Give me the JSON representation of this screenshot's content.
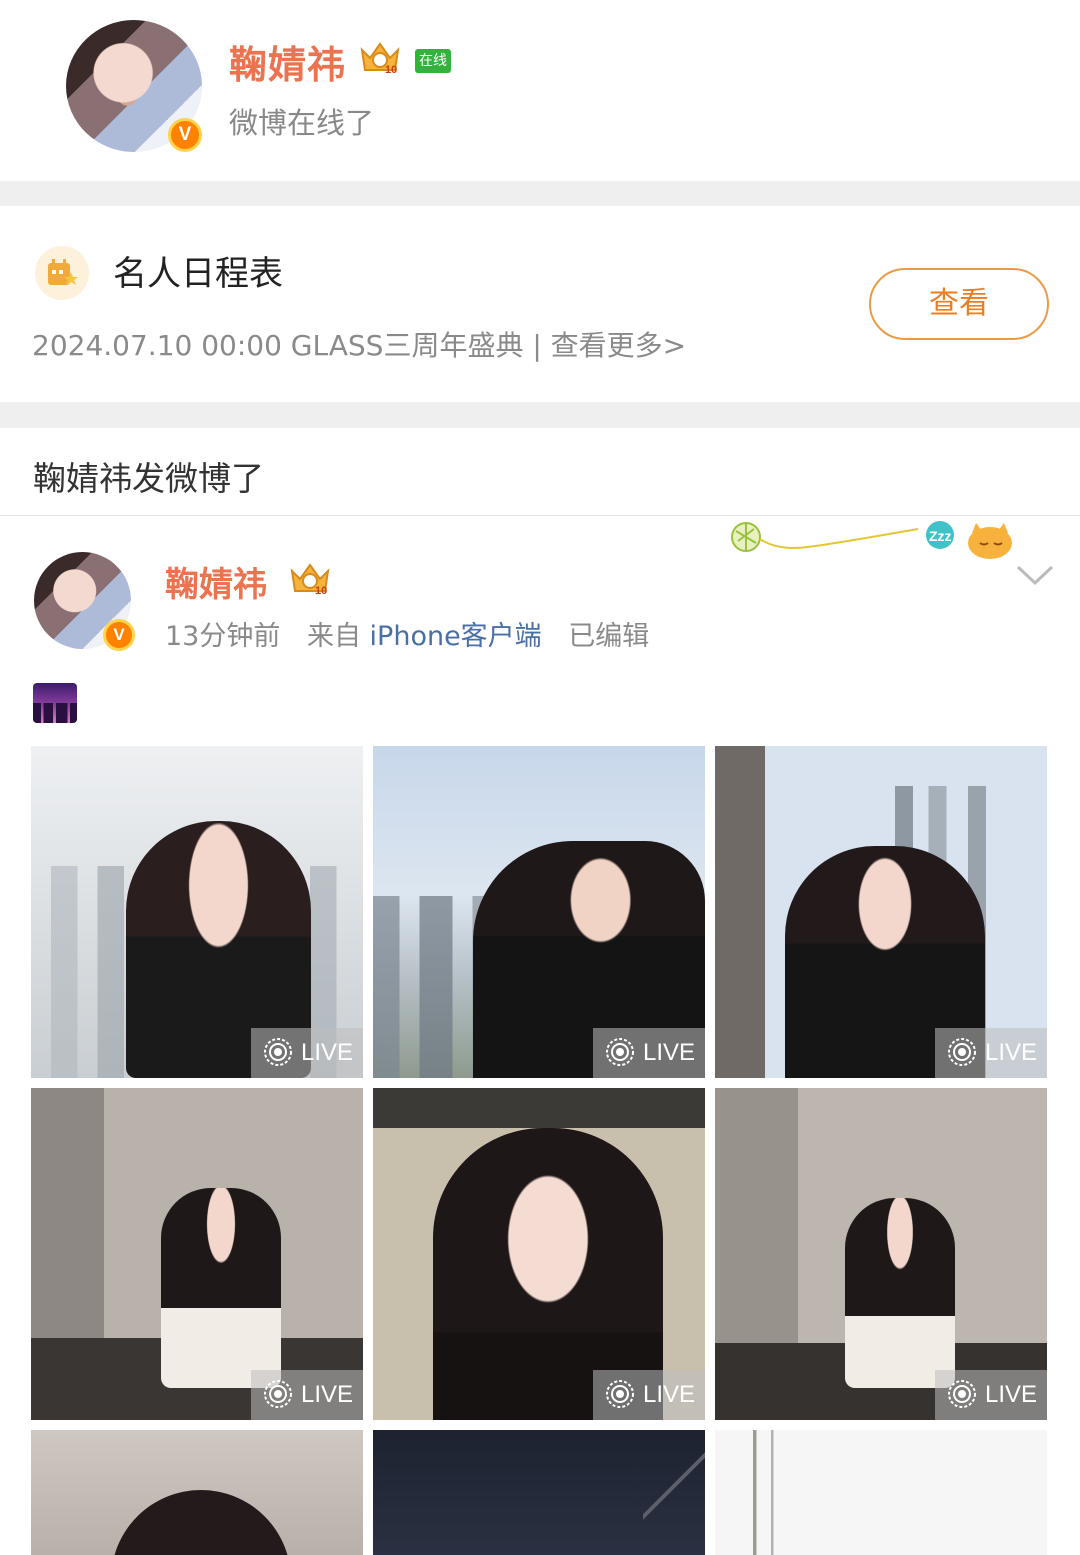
{
  "profile": {
    "name": "鞠婧祎",
    "vip_icon": "crown-level-10-icon",
    "online_tag": "在线",
    "status": "微博在线了",
    "verified_icon": "v-badge-icon"
  },
  "schedule": {
    "icon": "calendar-star-icon",
    "title": "名人日程表",
    "detail": "2024.07.10 00:00 GLASS三周年盛典 |  查看更多>",
    "button_label": "查看"
  },
  "post_bar": {
    "text": "鞠婧祎发微博了"
  },
  "post": {
    "author": "鞠婧祎",
    "time": "13分钟前",
    "source_prefix": "来自",
    "client": "iPhone客户端",
    "edited": "已编辑",
    "emoji": "night-city-emoji",
    "decoration": "sleeping-cat-yarn-decoration",
    "more_icon": "chevron-down-icon",
    "photos": [
      {
        "label": "LIVE",
        "scene": "city-window"
      },
      {
        "label": "LIVE",
        "scene": "city-window"
      },
      {
        "label": "LIVE",
        "scene": "city-window"
      },
      {
        "label": "LIVE",
        "scene": "restroom"
      },
      {
        "label": "LIVE",
        "scene": "marble-wall"
      },
      {
        "label": "LIVE",
        "scene": "restroom"
      },
      {
        "label": "",
        "scene": "restroom"
      },
      {
        "label": "",
        "scene": "dark-sky"
      },
      {
        "label": "",
        "scene": "white-wall"
      }
    ]
  },
  "colors": {
    "name_orange": "#eb7350",
    "button_orange": "#eb7d23",
    "online_green": "#33b33d",
    "link_blue": "#4a6fa5",
    "divider_gray": "#efefef"
  }
}
